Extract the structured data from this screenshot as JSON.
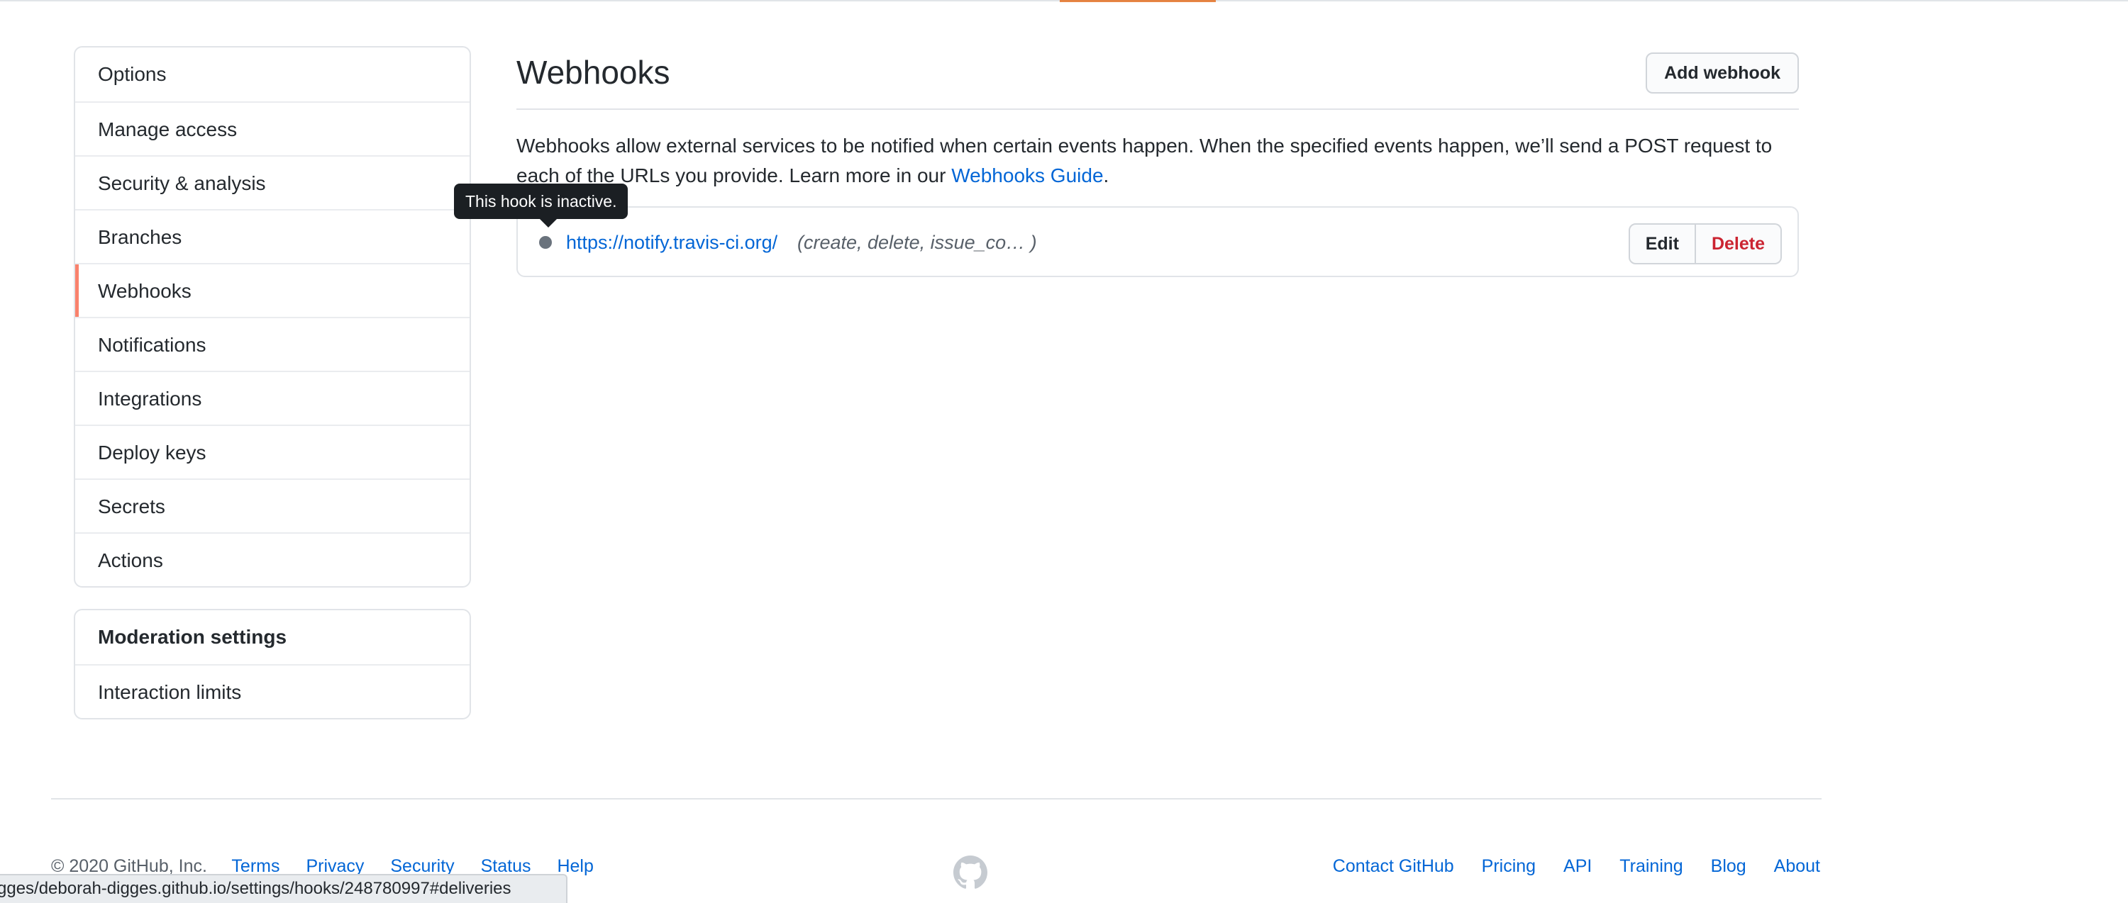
{
  "sidebar": {
    "items": [
      {
        "label": "Options"
      },
      {
        "label": "Manage access"
      },
      {
        "label": "Security & analysis"
      },
      {
        "label": "Branches"
      },
      {
        "label": "Webhooks",
        "selected": true
      },
      {
        "label": "Notifications"
      },
      {
        "label": "Integrations"
      },
      {
        "label": "Deploy keys"
      },
      {
        "label": "Secrets"
      },
      {
        "label": "Actions"
      }
    ],
    "moderation": {
      "heading": "Moderation settings",
      "items": [
        {
          "label": "Interaction limits"
        }
      ]
    }
  },
  "main": {
    "title": "Webhooks",
    "add_button": "Add webhook",
    "intro_text": "Webhooks allow external services to be notified when certain events happen. When the specified events happen, we’ll send a POST request to each of the URLs you provide. Learn more in our",
    "guide_link": "Webhooks Guide",
    "intro_end": "."
  },
  "hook": {
    "url": "https://notify.travis-ci.org/",
    "events": "(create, delete, issue_co…  )",
    "edit_label": "Edit",
    "delete_label": "Delete",
    "status_icon": "dot-icon",
    "status_color": "#6a737d"
  },
  "tooltip": {
    "text": "This hook is inactive."
  },
  "footer": {
    "copyright": "© 2020 GitHub, Inc.",
    "left_links": [
      "Terms",
      "Privacy",
      "Security",
      "Status",
      "Help"
    ],
    "right_links": [
      "Contact GitHub",
      "Pricing",
      "API",
      "Training",
      "Blog",
      "About"
    ],
    "logo_icon": "github-logo-icon"
  },
  "status_bar": {
    "url": "gges/deborah-digges.github.io/settings/hooks/248780997#deliveries"
  },
  "colors": {
    "accent": "#f9826c",
    "link": "#0366d6",
    "danger": "#cb2431"
  }
}
